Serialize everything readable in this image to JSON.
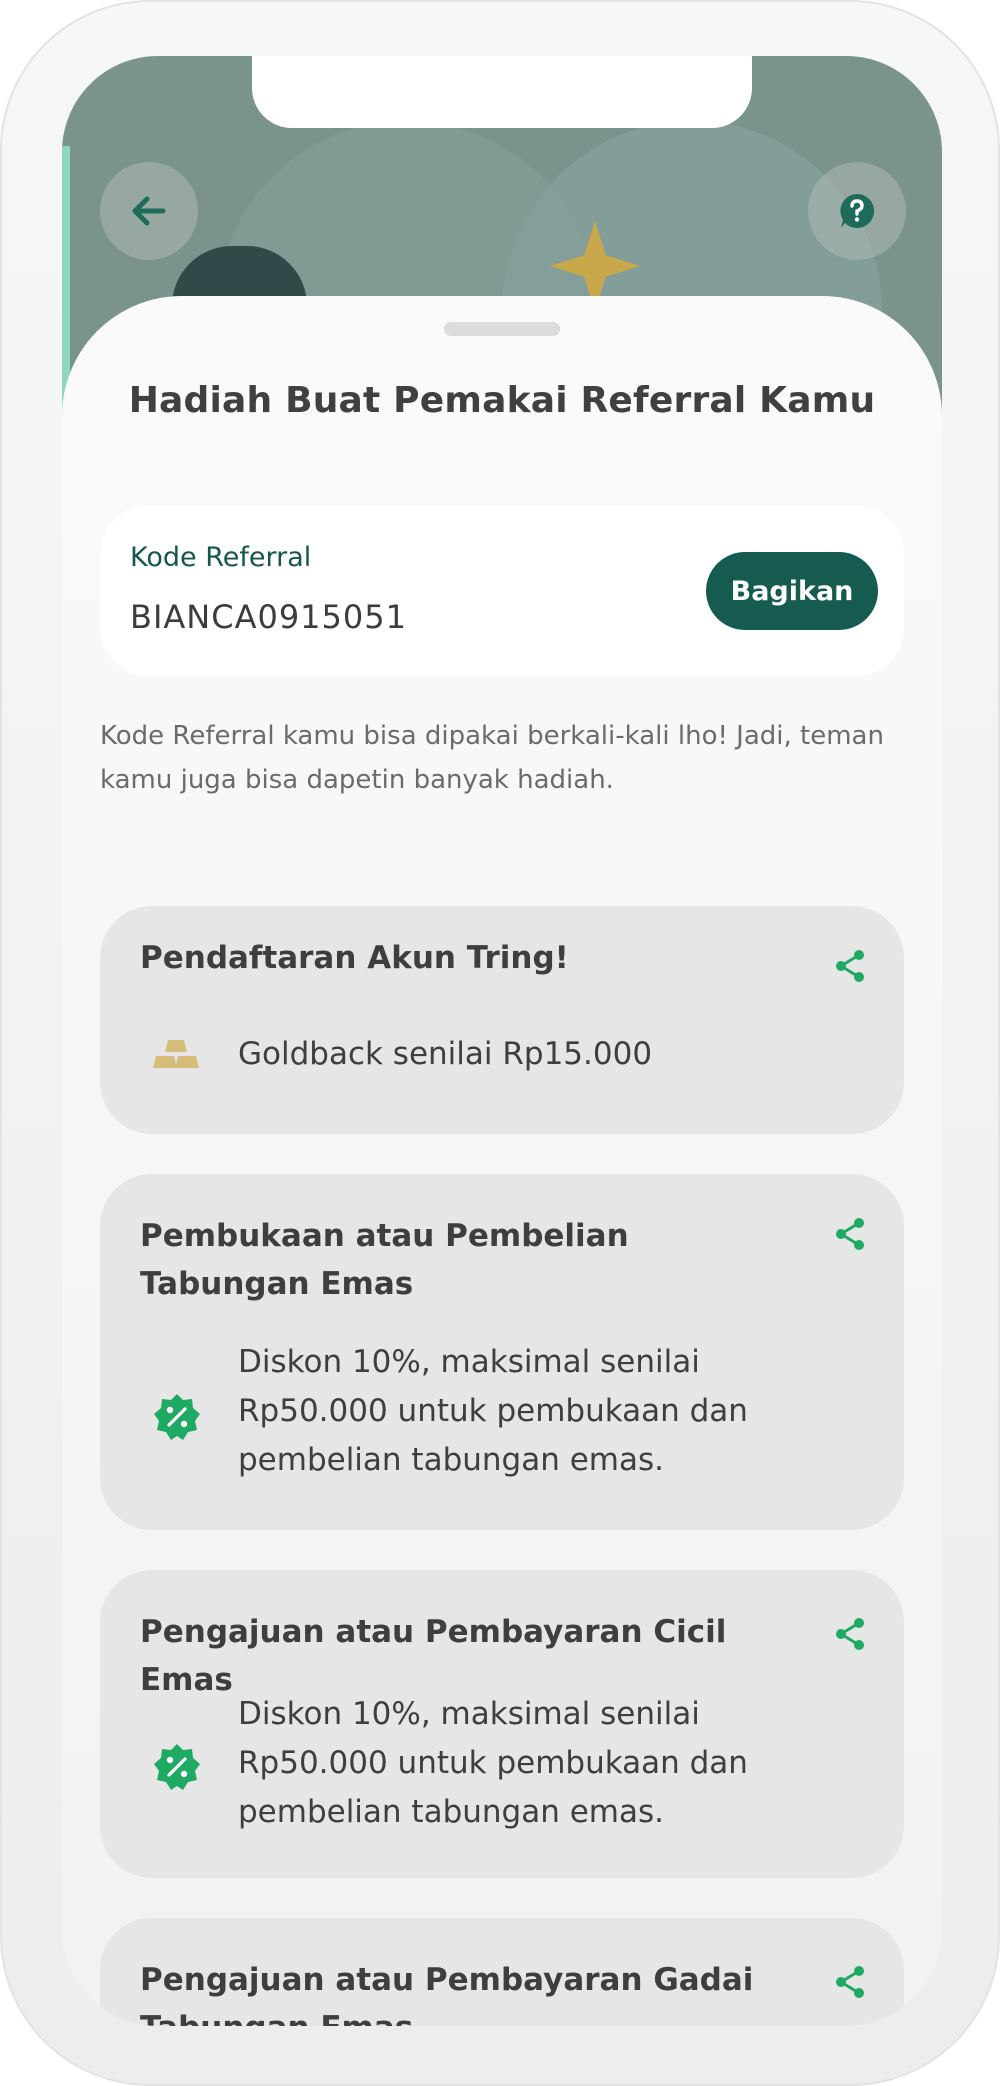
{
  "header": {
    "back_icon": "arrow-left-icon",
    "help_icon": "question-chat-icon"
  },
  "sheet": {
    "title": "Hadiah Buat Pemakai Referral Kamu"
  },
  "referral": {
    "label": "Kode Referral",
    "code": "BIANCA0915051",
    "share_label": "Bagikan"
  },
  "description": "Kode Referral kamu bisa dipakai berkali-kali lho! Jadi, teman kamu juga bisa dapetin banyak hadiah.",
  "rewards": [
    {
      "title": "Pendaftaran Akun Tring!",
      "icon": "gold-bars-icon",
      "text": "Goldback senilai Rp15.000"
    },
    {
      "title": "Pembukaan atau Pembelian Tabungan Emas",
      "icon": "discount-badge-icon",
      "text": "Diskon 10%, maksimal senilai Rp50.000 untuk pembukaan dan pembelian tabungan emas."
    },
    {
      "title": "Pengajuan atau Pembayaran Cicil Emas",
      "icon": "discount-badge-icon",
      "text": "Diskon 10%, maksimal senilai Rp50.000 untuk pembukaan dan pembelian tabungan emas."
    },
    {
      "title": "Pengajuan atau Pembayaran Gadai Tabungan Emas",
      "icon": "share-icon",
      "text": ""
    }
  ],
  "colors": {
    "primary": "#155b50",
    "accent_green": "#1faa63",
    "gold": "#d4bd78"
  }
}
